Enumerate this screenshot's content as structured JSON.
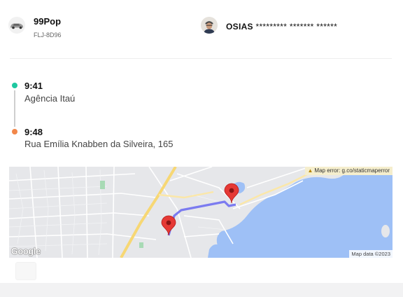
{
  "vehicle": {
    "name": "99Pop",
    "plate": "FLJ-8D96",
    "icon": "car-icon"
  },
  "driver": {
    "first_name": "OSIAS",
    "masked_name": "********* ******* ******",
    "icon": "driver-avatar"
  },
  "trip": {
    "start": {
      "time": "9:41",
      "place": "Agência Itaú",
      "color": "#1ec8a0"
    },
    "end": {
      "time": "9:48",
      "place": "Rua Emília Knabben da Silveira, 165",
      "color": "#f2874a"
    }
  },
  "map": {
    "error_text": "Map error: g.co/staticmaperror",
    "attribution": "Map data ©2023",
    "logo_text": "Google",
    "route_color": "#7b7bf0",
    "pin_color": "#e53935",
    "water_color": "#9ec0f6"
  }
}
